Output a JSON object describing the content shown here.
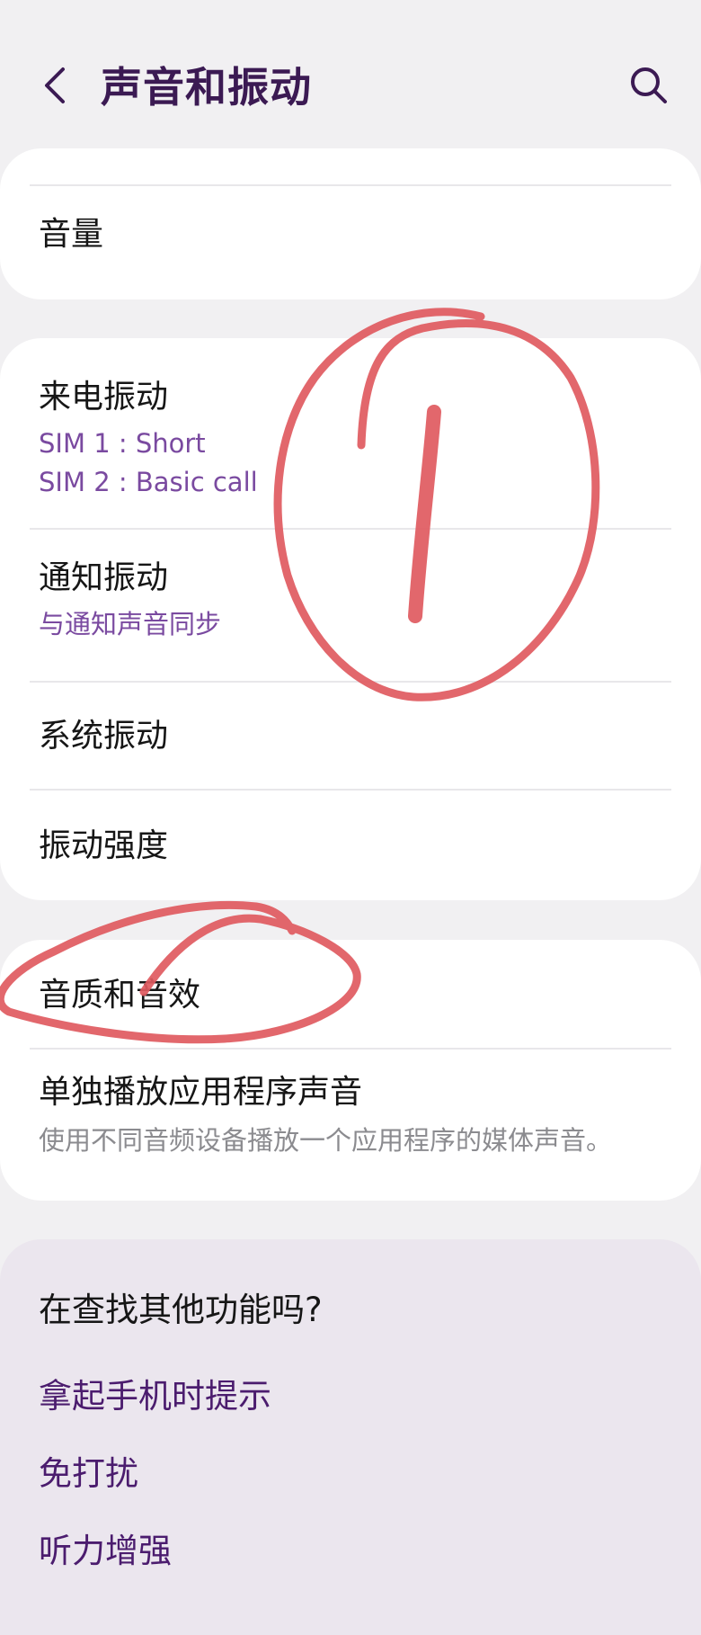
{
  "header": {
    "back_icon": "chevron-left-icon",
    "title": "声音和振动",
    "search_icon": "search-icon"
  },
  "volume_card": {
    "volume_label": "音量"
  },
  "vibration_card": {
    "call_vibration": {
      "title": "来电振动",
      "sim1": "SIM 1 : Short",
      "sim2": "SIM 2 : Basic call"
    },
    "notification_vibration": {
      "title": "通知振动",
      "subtitle": "与通知声音同步"
    },
    "system_vibration": {
      "title": "系统振动"
    },
    "vibration_intensity": {
      "title": "振动强度"
    }
  },
  "audio_card": {
    "sound_quality": {
      "title": "音质和音效"
    },
    "separate_app_sound": {
      "title": "单独播放应用程序声音",
      "subtitle": "使用不同音频设备播放一个应用程序的媒体声音。"
    }
  },
  "find_more": {
    "title": "在查找其他功能吗?",
    "links": [
      "拿起手机时提示",
      "免打扰",
      "听力增强"
    ]
  },
  "colors": {
    "background": "#f1f0f2",
    "title": "#3b1a53",
    "accent_subtitle": "#7a4aa0",
    "link": "#4b1c6e",
    "annotation": "#e05a60"
  }
}
